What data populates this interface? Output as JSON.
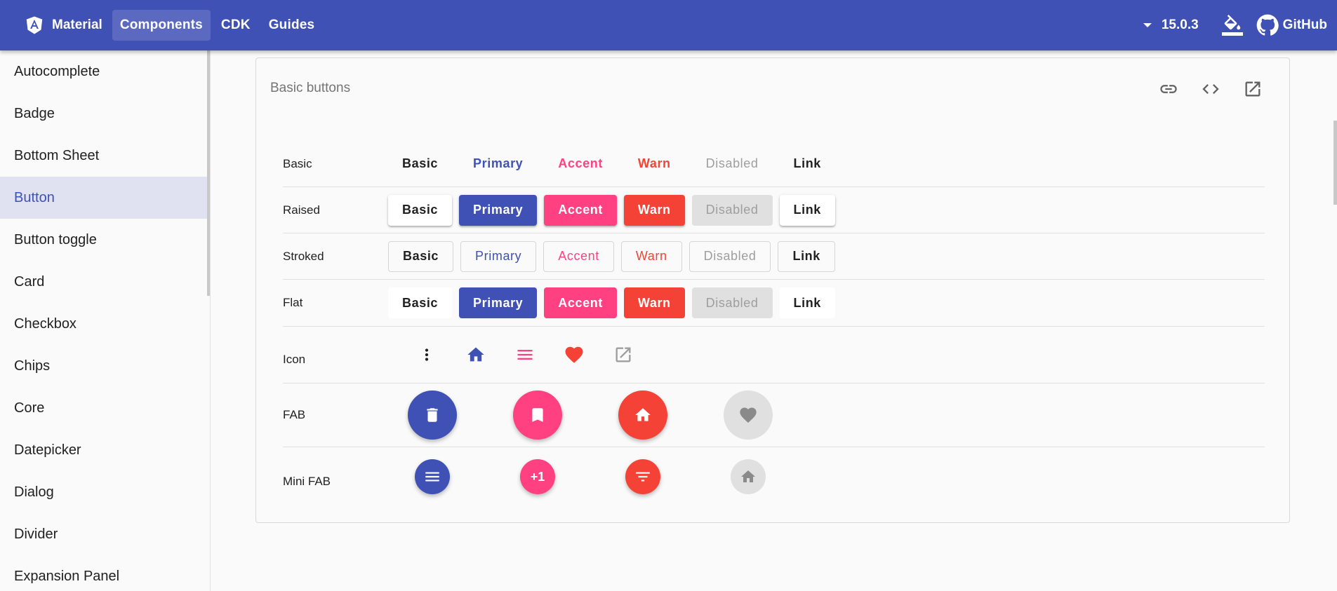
{
  "topbar": {
    "brand": "Material",
    "nav": [
      "Components",
      "CDK",
      "Guides"
    ],
    "version": "15.0.3",
    "github": "GitHub"
  },
  "sidebar": {
    "items": [
      "Autocomplete",
      "Badge",
      "Bottom Sheet",
      "Button",
      "Button toggle",
      "Card",
      "Checkbox",
      "Chips",
      "Core",
      "Datepicker",
      "Dialog",
      "Divider",
      "Expansion Panel"
    ],
    "active": "Button"
  },
  "example": {
    "title": "Basic buttons",
    "rows": {
      "basic": {
        "label": "Basic",
        "buttons": [
          "Basic",
          "Primary",
          "Accent",
          "Warn",
          "Disabled",
          "Link"
        ]
      },
      "raised": {
        "label": "Raised",
        "buttons": [
          "Basic",
          "Primary",
          "Accent",
          "Warn",
          "Disabled",
          "Link"
        ]
      },
      "stroked": {
        "label": "Stroked",
        "buttons": [
          "Basic",
          "Primary",
          "Accent",
          "Warn",
          "Disabled",
          "Link"
        ]
      },
      "flat": {
        "label": "Flat",
        "buttons": [
          "Basic",
          "Primary",
          "Accent",
          "Warn",
          "Disabled",
          "Link"
        ]
      },
      "icon": {
        "label": "Icon",
        "icons": [
          "more-vert-icon",
          "home-icon",
          "menu-icon",
          "favorite-icon",
          "open-in-new-icon"
        ]
      },
      "fab": {
        "label": "FAB",
        "icons": [
          "delete-icon",
          "bookmark-icon",
          "home-icon",
          "favorite-icon"
        ]
      },
      "minifab": {
        "label": "Mini FAB",
        "icons": [
          "menu-icon",
          "plus-one-icon",
          "filter-list-icon",
          "home-icon"
        ],
        "plus_one": "+1"
      }
    }
  },
  "colors": {
    "primary": "#3f51b5",
    "accent": "#ff4081",
    "warn": "#f44336",
    "disabled": "#9e9e9e"
  }
}
